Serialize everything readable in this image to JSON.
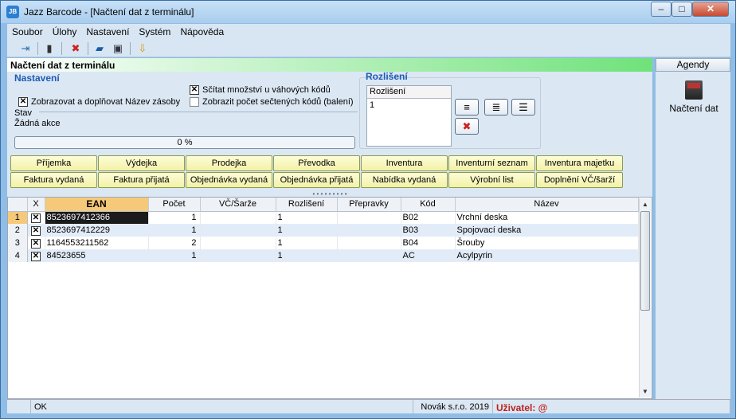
{
  "window": {
    "title": "Jazz Barcode - [Načtení dat z terminálu]",
    "app_icon_text": "JB",
    "minimize": "–",
    "maximize": "□",
    "close": "✕"
  },
  "menu": {
    "items": [
      "Soubor",
      "Úlohy",
      "Nastavení",
      "Systém",
      "Nápověda"
    ]
  },
  "toolbar": {
    "icons": [
      "exit-icon",
      "terminal-icon",
      "delete-icon",
      "open-folder-icon",
      "save-icon",
      "import-icon"
    ]
  },
  "panel": {
    "title": "Načtení dat z terminálu",
    "settings_caption": "Nastavení",
    "sum_weight_label": "Sčítat množství u váhových kódů",
    "sum_weight_checked": true,
    "show_name_label": "Zobrazovat a doplňovat Název zásoby",
    "show_name_checked": true,
    "show_count_label": "Zobrazit počet sečtených kódů (balení)",
    "show_count_checked": false,
    "state_label": "Stav",
    "state_value": "Žádná akce",
    "progress_text": "0 %",
    "progress_value": 0
  },
  "resolution": {
    "caption": "Rozlišení",
    "list_header": "Rozlišení",
    "items": [
      "1"
    ]
  },
  "doc_buttons": {
    "row1": [
      "Příjemka",
      "Výdejka",
      "Prodejka",
      "Převodka",
      "Inventura",
      "Inventurní seznam",
      "Inventura majetku"
    ],
    "row2": [
      "Faktura vydaná",
      "Faktura přijatá",
      "Objednávka vydaná",
      "Objednávka přijatá",
      "Nabídka vydaná",
      "Výrobní list",
      "Doplnění VČ/šarží"
    ]
  },
  "grid": {
    "columns": [
      "X",
      "EAN",
      "Počet",
      "VČ/Šarže",
      "Rozlišení",
      "Přepravky",
      "Kód",
      "Název"
    ],
    "rows": [
      {
        "n": "1",
        "x": true,
        "ean": "8523697412366",
        "pocet": "1",
        "vc": "",
        "rozliseni": "1",
        "prepravky": "",
        "kod": "B02",
        "nazev": "Vrchní deska"
      },
      {
        "n": "2",
        "x": true,
        "ean": "8523697412229",
        "pocet": "1",
        "vc": "",
        "rozliseni": "1",
        "prepravky": "",
        "kod": "B03",
        "nazev": "Spojovací deska"
      },
      {
        "n": "3",
        "x": true,
        "ean": "1164553211562",
        "pocet": "2",
        "vc": "",
        "rozliseni": "1",
        "prepravky": "",
        "kod": "B04",
        "nazev": "Šrouby"
      },
      {
        "n": "4",
        "x": true,
        "ean": "84523655",
        "pocet": "1",
        "vc": "",
        "rozliseni": "1",
        "prepravky": "",
        "kod": "AC",
        "nazev": "Acylpyrin"
      }
    ]
  },
  "side": {
    "header": "Agendy",
    "tile_label": "Načtení dat"
  },
  "status": {
    "left": "OK",
    "company": "Novák s.r.o. 2019",
    "user_label": "Uživatel: @"
  },
  "colors": {
    "accent": "#f6c97a",
    "panel_title_gradient": "#6fe27a",
    "caption": "#1d5bb6",
    "user_label": "#c0201c"
  }
}
